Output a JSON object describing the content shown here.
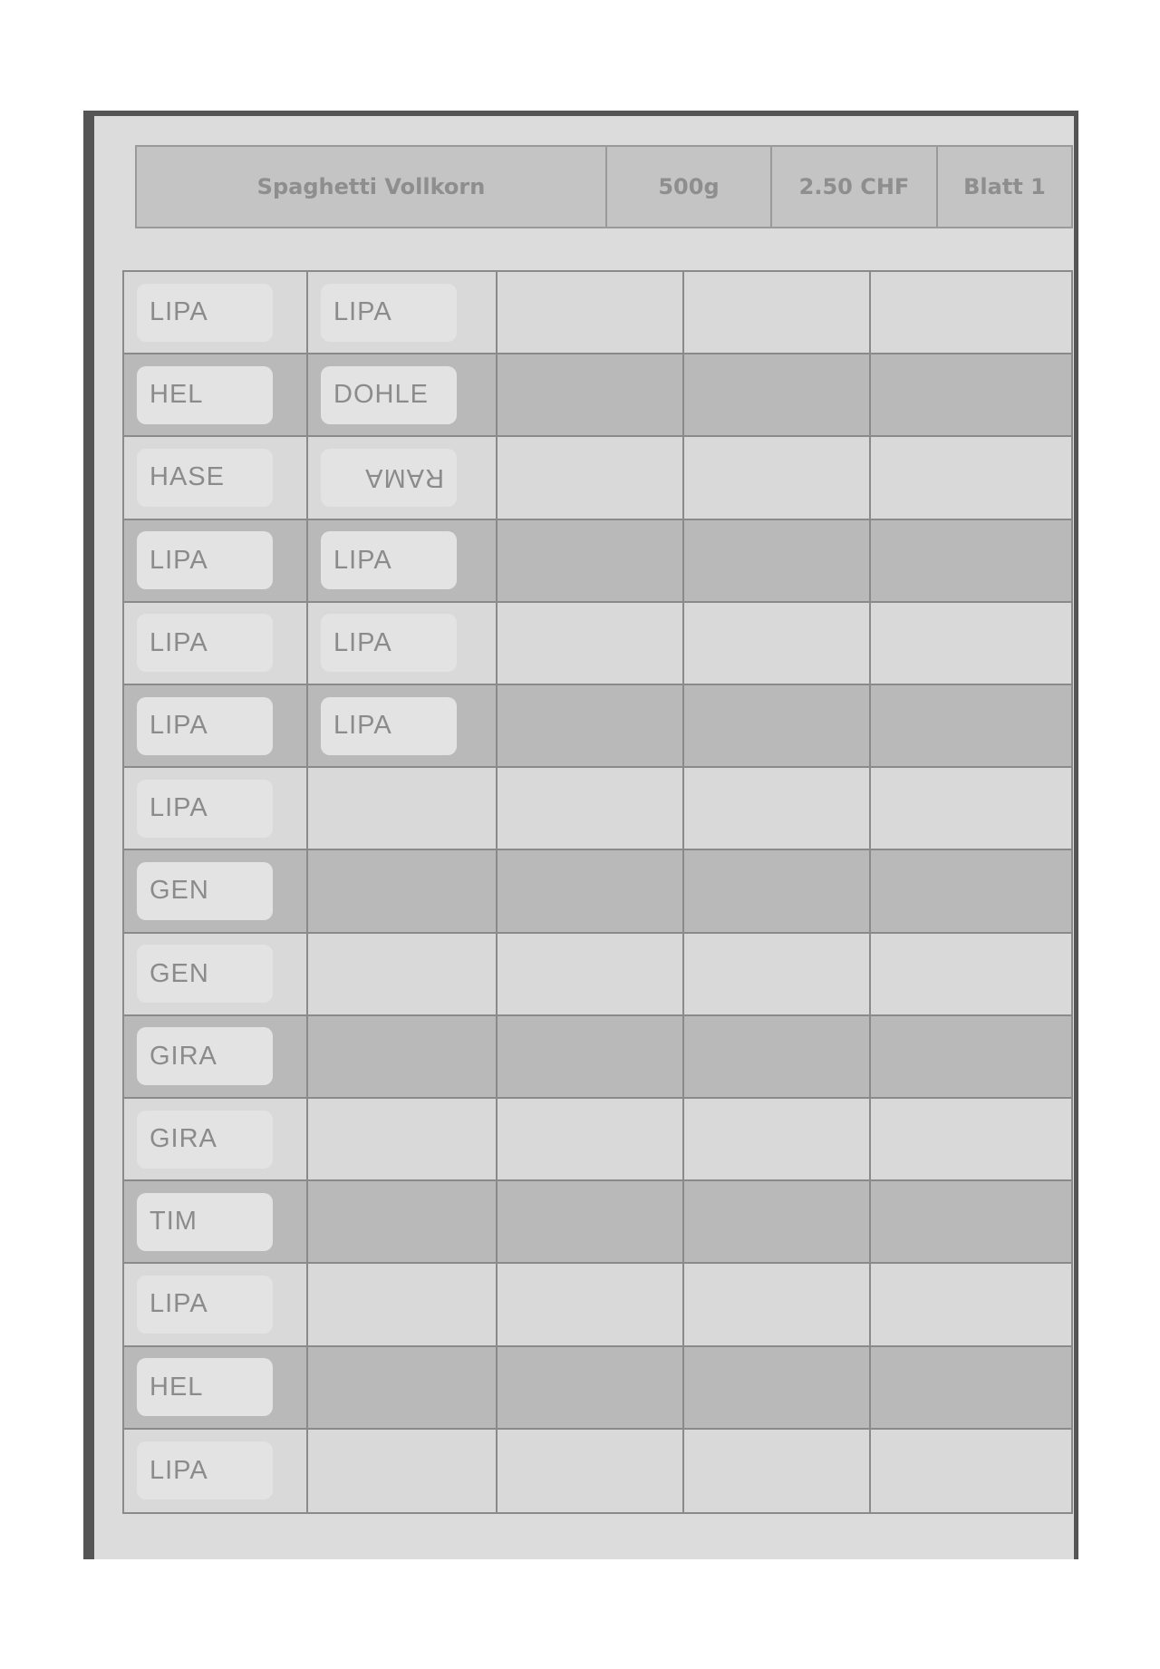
{
  "header": {
    "product": "Spaghetti Vollkorn",
    "weight": "500g",
    "price": "2.50 CHF",
    "sheet": "Blatt 1"
  },
  "table": {
    "columns": 5,
    "rows": [
      [
        "LIPA",
        "LIPA",
        "",
        "",
        ""
      ],
      [
        "HEL",
        "DOHLE",
        "",
        "",
        ""
      ],
      [
        "HASE",
        "RAMA",
        "",
        "",
        ""
      ],
      [
        "LIPA",
        "LIPA",
        "",
        "",
        ""
      ],
      [
        "LIPA",
        "LIPA",
        "",
        "",
        ""
      ],
      [
        "LIPA",
        "LIPA",
        "",
        "",
        ""
      ],
      [
        "LIPA",
        "",
        "",
        "",
        ""
      ],
      [
        "GEN",
        "",
        "",
        "",
        ""
      ],
      [
        "GEN",
        "",
        "",
        "",
        ""
      ],
      [
        "GIRA",
        "",
        "",
        "",
        ""
      ],
      [
        "GIRA",
        "",
        "",
        "",
        ""
      ],
      [
        "TIM",
        "",
        "",
        "",
        ""
      ],
      [
        "LIPA",
        "",
        "",
        "",
        ""
      ],
      [
        "HEL",
        "",
        "",
        "",
        ""
      ],
      [
        "LIPA",
        "",
        "",
        "",
        ""
      ]
    ],
    "upside_down_cells": [
      [
        2,
        1
      ]
    ]
  }
}
